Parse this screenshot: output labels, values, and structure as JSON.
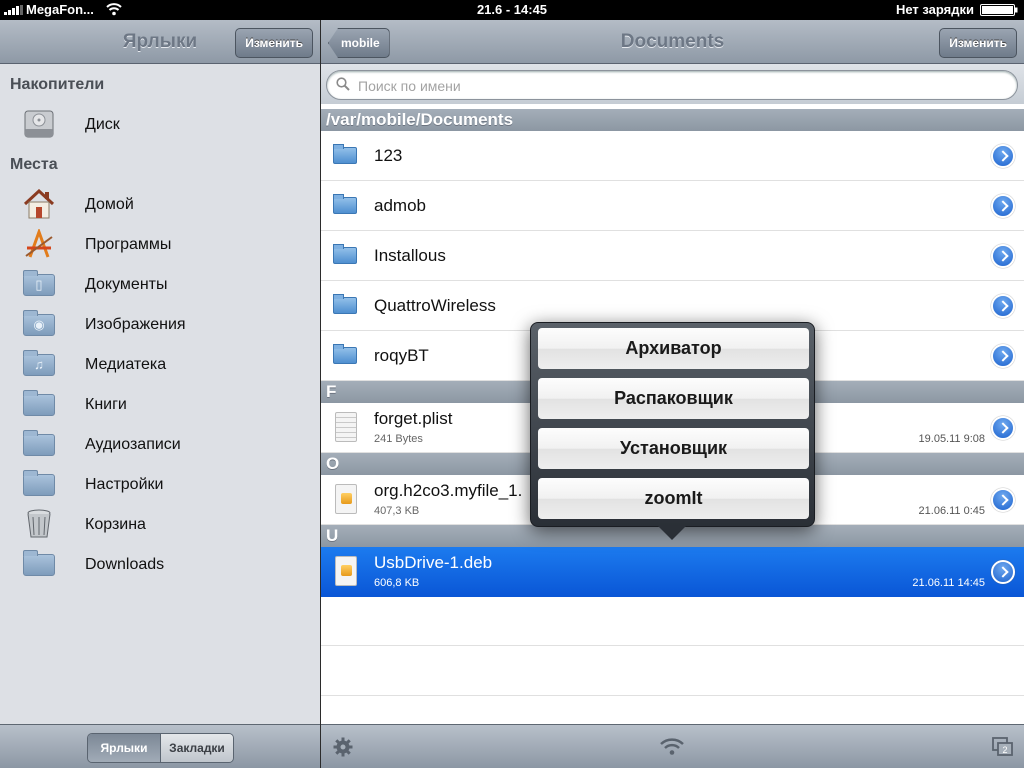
{
  "status": {
    "carrier": "MegaFon...",
    "time": "21.6 - 14:45",
    "charging": "Нет зарядки"
  },
  "left": {
    "title": "Ярлыки",
    "edit_label": "Изменить",
    "section_storage": "Накопители",
    "disk_label": "Диск",
    "section_places": "Места",
    "places": [
      {
        "label": "Домой",
        "icon": "home-icon"
      },
      {
        "label": "Программы",
        "icon": "apps-icon"
      },
      {
        "label": "Документы",
        "icon": "documents-folder-icon"
      },
      {
        "label": "Изображения",
        "icon": "pictures-folder-icon"
      },
      {
        "label": "Медиатека",
        "icon": "music-folder-icon"
      },
      {
        "label": "Книги",
        "icon": "folder-icon"
      },
      {
        "label": "Аудиозаписи",
        "icon": "folder-icon"
      },
      {
        "label": "Настройки",
        "icon": "folder-icon"
      },
      {
        "label": "Корзина",
        "icon": "trash-icon"
      },
      {
        "label": "Downloads",
        "icon": "folder-icon"
      }
    ],
    "segments": {
      "shortcuts": "Ярлыки",
      "bookmarks": "Закладки"
    }
  },
  "right": {
    "back_label": "mobile",
    "title": "Documents",
    "edit_label": "Изменить",
    "search_placeholder": "Поиск по имени",
    "path_header": "/var/mobile/Documents",
    "folders": [
      "123",
      "admob",
      "Installous",
      "QuattroWireless",
      "roqyBT"
    ],
    "sections": [
      {
        "letter": "F",
        "file": {
          "name": "forget.plist",
          "size": "241 Bytes",
          "date": "19.05.11 9:08"
        }
      },
      {
        "letter": "O",
        "file": {
          "name": "org.h2co3.myfile_1.",
          "size": "407,3 KB",
          "date": "21.06.11 0:45"
        }
      },
      {
        "letter": "U",
        "file": {
          "name": "UsbDrive-1.deb",
          "size": "606,8 KB",
          "date": "21.06.11 14:45"
        }
      }
    ],
    "tabs_count": "2"
  },
  "popover": {
    "items": [
      "Архиватор",
      "Распаковщик",
      "Установщик",
      "zoomIt"
    ]
  },
  "colors": {
    "selection": "#0a56d6",
    "disclosure": "#1d63cf"
  }
}
